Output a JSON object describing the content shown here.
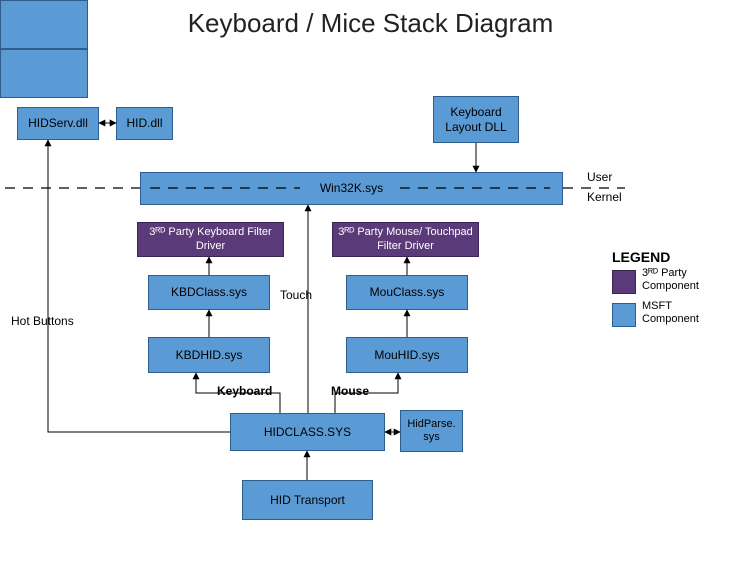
{
  "title": "Keyboard / Mice Stack Diagram",
  "boxes": {
    "hidserv": "HIDServ.dll",
    "hiddll": "HID.dll",
    "kbdlayout": "Keyboard Layout DLL",
    "win32k": "Win32K.sys",
    "kbfilter": "3ᴿᴰ Party Keyboard Filter Driver",
    "moufilter": "3ᴿᴰ Party Mouse/ Touchpad Filter Driver",
    "kbdclass": "KBDClass.sys",
    "mouclass": "MouClass.sys",
    "kbdhid": "KBDHID.sys",
    "mouhid": "MouHID.sys",
    "hidclass": "HIDCLASS.SYS",
    "hidparse": "HidParse. sys",
    "hidtransport": "HID Transport"
  },
  "labels": {
    "user": "User",
    "kernel": "Kernel",
    "hotbuttons": "Hot Buttons",
    "touch": "Touch",
    "keyboard": "Keyboard",
    "mouse": "Mouse"
  },
  "legend": {
    "title": "LEGEND",
    "third": "3ᴿᴰ Party Component",
    "msft": "MSFT Component"
  }
}
